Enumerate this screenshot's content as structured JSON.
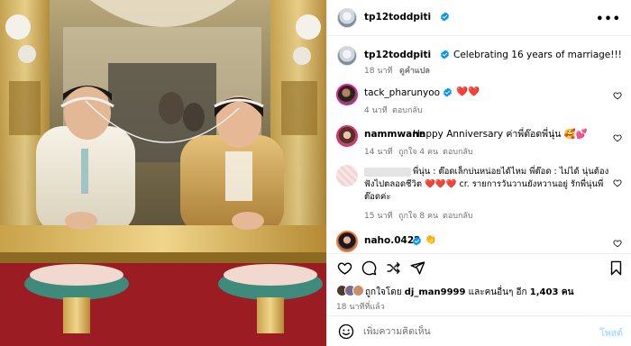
{
  "post": {
    "author": "tp12toddpiti",
    "photo_alt": "wedding photo"
  },
  "header": {
    "username": "tp12toddpiti",
    "more_label": "•••"
  },
  "caption": {
    "username": "tp12toddpiti",
    "text": "Celebrating 16 years of marriage!!!",
    "time": "18 นาที",
    "translate_label": "ดูคำแปล"
  },
  "comments": [
    {
      "username": "tack_pharunyoo",
      "text": "❤️❤️",
      "time": "4 นาที",
      "reply_label": "ตอบกลับ",
      "likes": ""
    },
    {
      "username": "nammwann",
      "text": "Happy Anniversary ค่าพี่ต๊อดพี่นุ่น 🥰💕",
      "time": "14 นาที",
      "likes": "ถูกใจ 4 คน",
      "reply_label": "ตอบกลับ"
    },
    {
      "username": "",
      "text_line1": "พี่นุ่น : ต๊อดเล็กบ่นหน่อยได้ไหม พี่ต๊อด : ไม่ได้ นุ่นต้อง",
      "text_line2": "ฟังไปตลอดชีวิต ❤️❤️❤️ cr. รายการวันวานยังหวานอยู่ รักพี่นุ่นพี่",
      "text_line3": "ต๊อดค่ะ",
      "time": "15 นาที",
      "likes": "ถูกใจ 8 คน",
      "reply_label": "ตอบกลับ"
    },
    {
      "username": "naho.0422",
      "text": "👏"
    }
  ],
  "actions": {
    "like_icon": "heart-icon",
    "comment_icon": "comment-icon",
    "share_icon": "share-icon",
    "send_icon": "send-icon",
    "save_icon": "bookmark-icon"
  },
  "likes": {
    "prefix": "ถูกใจโดย",
    "user": "dj_man9999",
    "middle": "และคนอื่นๆ อีก",
    "count": "1,403 คน"
  },
  "post_time": "18 นาทีที่แล้ว",
  "comment_box": {
    "placeholder": "เพิ่มความคิดเห็น",
    "post_label": "โพสต์"
  },
  "colors": {
    "accent": "#0095f6",
    "verified": "#0095f6",
    "muted": "#737373",
    "heart": "#ed4956"
  }
}
